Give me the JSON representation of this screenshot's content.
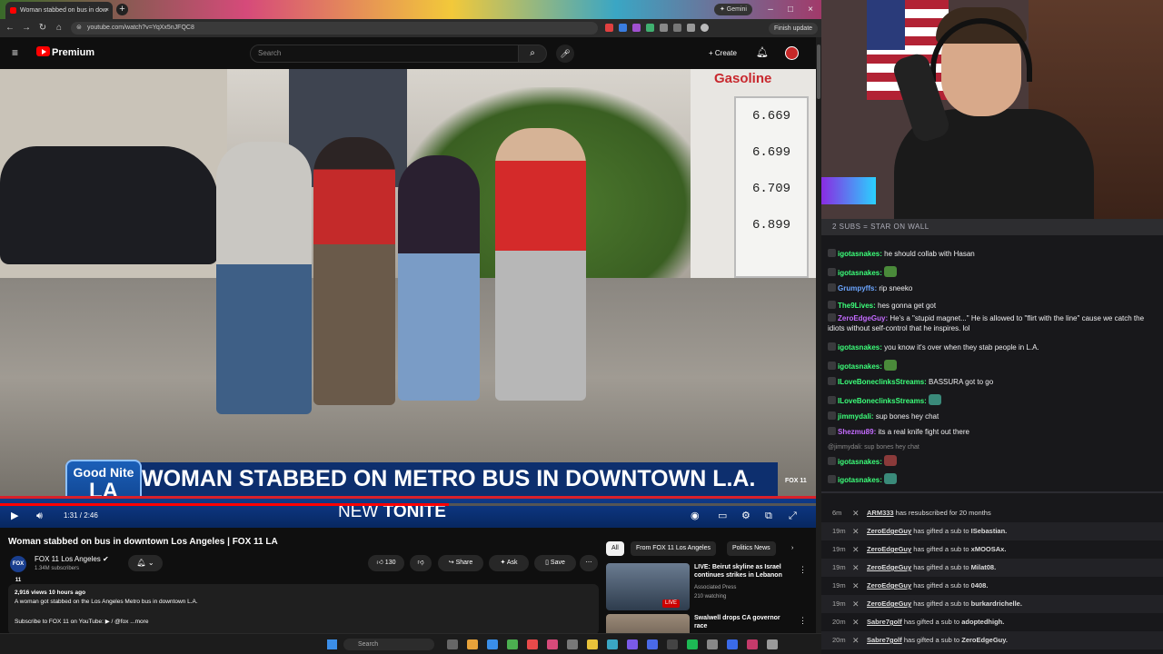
{
  "browser": {
    "tab_title": "Woman stabbed on bus in dow",
    "new_tab": "+",
    "gemini_label": "✦ Gemini",
    "url": "youtube.com/watch?v=YqXx5nJFQC8",
    "finish_update": "Finish update"
  },
  "youtube_header": {
    "brand": "Premium",
    "search_placeholder": "Search",
    "create_label": "+  Create"
  },
  "video": {
    "gas_sign": "Gasoline",
    "gas_prices": [
      "6.669",
      "6.699",
      "6.709",
      "6.899"
    ],
    "lower_third": {
      "badge_top": "Good Nite",
      "badge_main": "LA",
      "headline": "WOMAN STABBED ON METRO BUS IN DOWNTOWN L.A.",
      "sub_new": "NEW",
      "sub_tonite": "TONITE",
      "station_bug": "FOX 11"
    },
    "time_current": "1:31",
    "time_total": "2:46",
    "time_display": "1:31 / 2:46",
    "progress_fraction": 0.55
  },
  "info": {
    "title": "Woman stabbed on bus in downtown Los Angeles | FOX 11 LA",
    "channel_name": "FOX 11 Los Angeles",
    "channel_avatar": "FOX 11",
    "subscribers": "1.34M subscribers",
    "like_count": "130",
    "share_label": "Share",
    "ask_label": "Ask",
    "save_label": "Save",
    "description_stats": "2,916 views  10 hours ago",
    "description_line": "A woman got stabbed on the Los Angeles Metro bus in downtown L.A.",
    "description_sub": "Subscribe to FOX 11 on YouTube:  ▶ / @fox  ...more"
  },
  "recommendations": {
    "chips": [
      "All",
      "From FOX 11 Los Angeles",
      "Politics News"
    ],
    "items": [
      {
        "title": "LIVE: Beirut skyline as Israel continues strikes in Lebanon",
        "channel": "Associated Press",
        "meta": "210 watching",
        "badge": "LIVE"
      },
      {
        "title": "Swalwell drops CA governor race",
        "channel": "",
        "meta": "",
        "badge": ""
      }
    ]
  },
  "taskbar": {
    "search_placeholder": "Search"
  },
  "chat": {
    "goal": "2 SUBS = STAR ON WALL",
    "messages": [
      {
        "user": "igotasnakes",
        "color": "#3cff7a",
        "text": "he should collab with Hasan"
      },
      {
        "user": "igotasnakes",
        "color": "#3cff7a",
        "text": ""
      },
      {
        "user": "Grumpyffs",
        "color": "#6ca6ff",
        "text": "rip sneeko"
      },
      {
        "user": "The9Lives",
        "color": "#3cff7a",
        "text": "hes gonna get got"
      },
      {
        "user": "ZeroEdgeGuy",
        "color": "#c46bff",
        "text": "He's a \"stupid magnet...\" He is allowed to \"flirt with the line\" cause we catch the idiots without self-control that he inspires. lol"
      },
      {
        "user": "igotasnakes",
        "color": "#3cff7a",
        "text": "you know it's over when they stab people in L.A."
      },
      {
        "user": "igotasnakes",
        "color": "#3cff7a",
        "text": ""
      },
      {
        "user": "ILoveBoneclinksStreams",
        "color": "#3cff7a",
        "text": "BASSURA got to go"
      },
      {
        "user": "ILoveBoneclinksStreams",
        "color": "#3cff7a",
        "text": ""
      },
      {
        "user": "jimmydali",
        "color": "#3cff7a",
        "text": "sup bones hey chat"
      },
      {
        "user": "Shezmu89",
        "color": "#c46bff",
        "text": "its a real knife fight out there"
      },
      {
        "user": "",
        "color": "#898989",
        "text": "@jimmydali: sup bones hey chat"
      },
      {
        "user": "igotasnakes",
        "color": "#3cff7a",
        "text": ""
      },
      {
        "user": "igotasnakes",
        "color": "#3cff7a",
        "text": ""
      }
    ]
  },
  "events": [
    {
      "time": "6m",
      "user": "ARM333",
      "text": " has resubscribed for 20 months",
      "target": ""
    },
    {
      "time": "19m",
      "user": "ZeroEdgeGuy",
      "text": " has gifted a sub to ",
      "target": "ISebastian."
    },
    {
      "time": "19m",
      "user": "ZeroEdgeGuy",
      "text": " has gifted a sub to ",
      "target": "xMOOSAx."
    },
    {
      "time": "19m",
      "user": "ZeroEdgeGuy",
      "text": " has gifted a sub to ",
      "target": "Milat08."
    },
    {
      "time": "19m",
      "user": "ZeroEdgeGuy",
      "text": " has gifted a sub to ",
      "target": "0408."
    },
    {
      "time": "19m",
      "user": "ZeroEdgeGuy",
      "text": " has gifted a sub to ",
      "target": "burkardrichelle."
    },
    {
      "time": "20m",
      "user": "Sabre7golf",
      "text": " has gifted a sub to ",
      "target": "adoptedhigh."
    },
    {
      "time": "20m",
      "user": "Sabre7golf",
      "text": " has gifted a sub to ",
      "target": "ZeroEdgeGuy."
    }
  ]
}
